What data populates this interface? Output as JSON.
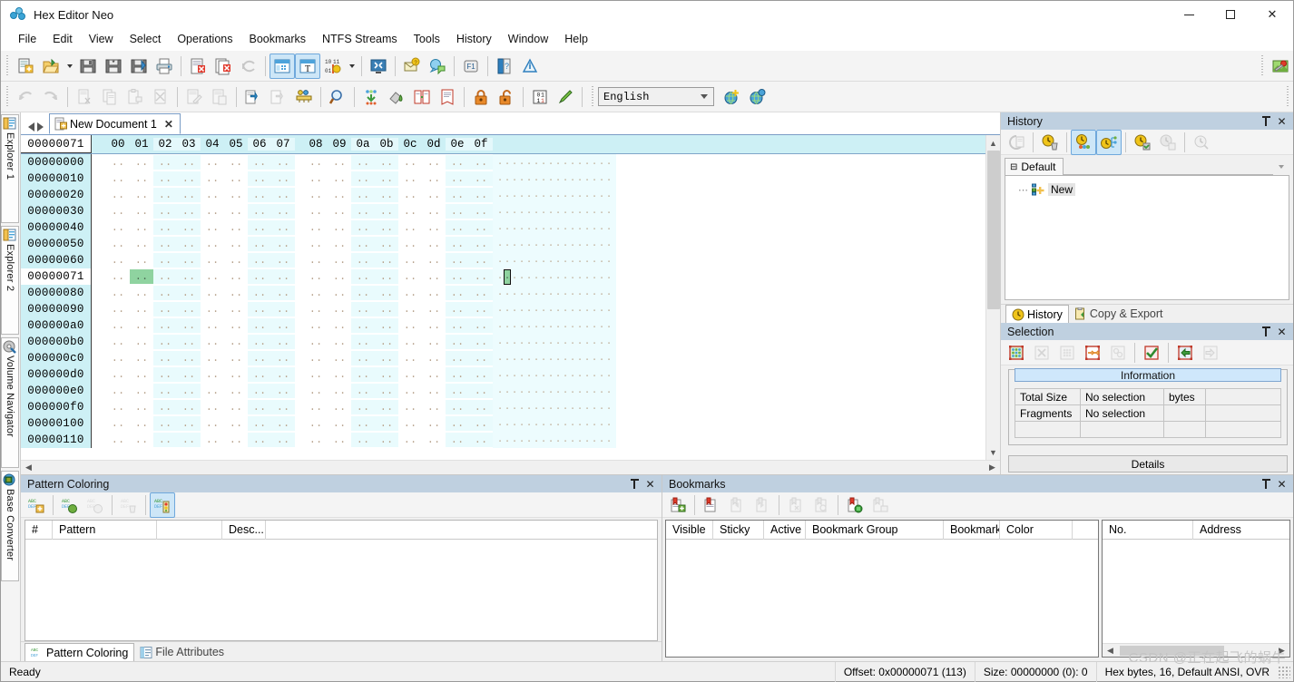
{
  "window": {
    "title": "Hex Editor Neo",
    "logo_icon": "hex-editor-neo-logo",
    "minimize_label": "Minimize",
    "maximize_label": "Maximize",
    "close_label": "Close"
  },
  "menubar": {
    "items": [
      {
        "label": "File"
      },
      {
        "label": "Edit"
      },
      {
        "label": "View"
      },
      {
        "label": "Select"
      },
      {
        "label": "Operations"
      },
      {
        "label": "Bookmarks"
      },
      {
        "label": "NTFS Streams"
      },
      {
        "label": "Tools"
      },
      {
        "label": "History"
      },
      {
        "label": "Window"
      },
      {
        "label": "Help"
      }
    ]
  },
  "toolbar_main": {
    "buttons": [
      {
        "name": "new-document-icon",
        "tip": "New Document"
      },
      {
        "name": "open-file-icon",
        "tip": "Open File"
      },
      {
        "name": "open-file-dropdown-icon",
        "tip": "Open recent"
      },
      {
        "name": "save-icon",
        "tip": "Save"
      },
      {
        "name": "save-as-icon",
        "tip": "Save As"
      },
      {
        "name": "save-all-icon",
        "tip": "Save All"
      },
      {
        "name": "print-icon",
        "tip": "Print"
      },
      {
        "name": "close-document-icon",
        "tip": "Close Document"
      },
      {
        "name": "close-all-documents-icon",
        "tip": "Close All Documents"
      },
      {
        "name": "refresh-icon",
        "tip": "Refresh"
      },
      {
        "name": "hex-view-icon",
        "tip": "Hex View"
      },
      {
        "name": "text-view-icon",
        "tip": "Text View"
      },
      {
        "name": "data-encoding-icon",
        "tip": "Data Encoding"
      },
      {
        "name": "data-encoding-dropdown-icon",
        "tip": "Data Encoding Options"
      },
      {
        "name": "fullscreen-icon",
        "tip": "Full Screen"
      },
      {
        "name": "send-feedback-icon",
        "tip": "Send Feedback"
      },
      {
        "name": "support-icon",
        "tip": "Support"
      },
      {
        "name": "help-f1-icon",
        "tip": "Help"
      },
      {
        "name": "manual-icon",
        "tip": "Manual"
      },
      {
        "name": "about-icon",
        "tip": "About"
      },
      {
        "name": "customize-icon",
        "tip": "Customize"
      }
    ]
  },
  "toolbar_edit": {
    "language_value": "English",
    "language_placeholder": "English",
    "buttons": [
      {
        "name": "undo-icon",
        "tip": "Undo"
      },
      {
        "name": "redo-icon",
        "tip": "Redo"
      },
      {
        "name": "cut-icon",
        "tip": "Cut"
      },
      {
        "name": "copy-icon",
        "tip": "Copy"
      },
      {
        "name": "paste-icon",
        "tip": "Paste"
      },
      {
        "name": "delete-icon",
        "tip": "Delete"
      },
      {
        "name": "edit-icon",
        "tip": "Edit"
      },
      {
        "name": "clipboard-icon",
        "tip": "Clipboard"
      },
      {
        "name": "export-icon",
        "tip": "Export"
      },
      {
        "name": "import-icon",
        "tip": "Import"
      },
      {
        "name": "measure-icon",
        "tip": "Measure"
      },
      {
        "name": "find-icon",
        "tip": "Find"
      },
      {
        "name": "fill-icon",
        "tip": "Fill"
      },
      {
        "name": "paint-icon",
        "tip": "Pattern Color"
      },
      {
        "name": "compare-icon",
        "tip": "Compare"
      },
      {
        "name": "checksum-icon",
        "tip": "Checksum"
      },
      {
        "name": "lock-icon",
        "tip": "Read Only"
      },
      {
        "name": "unlock-icon",
        "tip": "Read Write"
      },
      {
        "name": "binary-mode-icon",
        "tip": "Binary Mode"
      },
      {
        "name": "pencil-icon",
        "tip": "Edit Mode"
      },
      {
        "name": "add-language-icon",
        "tip": "Add Language"
      },
      {
        "name": "language-options-icon",
        "tip": "Language Options"
      }
    ]
  },
  "left_dock": {
    "tabs": [
      {
        "label": "Explorer 1",
        "icon": "explorer-icon"
      },
      {
        "label": "Explorer 2",
        "icon": "explorer-icon"
      },
      {
        "label": "Volume Navigator",
        "icon": "volume-navigator-icon"
      },
      {
        "label": "Base Converter",
        "icon": "base-converter-icon"
      }
    ]
  },
  "document": {
    "tab_label": "New Document 1",
    "tab_icon": "document-icon",
    "close_label": "✕",
    "prev_label": "Previous document",
    "next_label": "Next document"
  },
  "hexview": {
    "current_offset_label": "00000071",
    "columns": [
      "00",
      "01",
      "02",
      "03",
      "04",
      "05",
      "06",
      "07",
      "08",
      "09",
      "0a",
      "0b",
      "0c",
      "0d",
      "0e",
      "0f"
    ],
    "rows": [
      {
        "offset": "00000000",
        "current": false
      },
      {
        "offset": "00000010",
        "current": false
      },
      {
        "offset": "00000020",
        "current": false
      },
      {
        "offset": "00000030",
        "current": false
      },
      {
        "offset": "00000040",
        "current": false
      },
      {
        "offset": "00000050",
        "current": false
      },
      {
        "offset": "00000060",
        "current": false
      },
      {
        "offset": "00000071",
        "current": true
      },
      {
        "offset": "00000080",
        "current": false
      },
      {
        "offset": "00000090",
        "current": false
      },
      {
        "offset": "000000a0",
        "current": false
      },
      {
        "offset": "000000b0",
        "current": false
      },
      {
        "offset": "000000c0",
        "current": false
      },
      {
        "offset": "000000d0",
        "current": false
      },
      {
        "offset": "000000e0",
        "current": false
      },
      {
        "offset": "000000f0",
        "current": false
      },
      {
        "offset": "00000100",
        "current": false
      },
      {
        "offset": "00000110",
        "current": false
      }
    ],
    "byte_placeholder": "..",
    "ascii_placeholder": ".",
    "cursor_row_index": 7,
    "cursor_col_index": 1,
    "selection_color": "#8fd3a0",
    "row_band_color": "#cdf0f5"
  },
  "history_panel": {
    "title": "History",
    "pin_label": "Auto Hide",
    "close_label": "✕",
    "toolbar_buttons": [
      {
        "name": "history-properties-icon",
        "tip": "Properties"
      },
      {
        "name": "clear-history-icon",
        "tip": "Clear History"
      },
      {
        "name": "show-branches-icon",
        "tip": "Show Branches"
      },
      {
        "name": "tree-view-icon",
        "tip": "Tree View"
      },
      {
        "name": "save-history-icon",
        "tip": "Save History"
      },
      {
        "name": "load-history-icon",
        "tip": "Load History"
      },
      {
        "name": "history-settings-icon",
        "tip": "History Settings"
      }
    ],
    "group_tab": "Default",
    "chevron_label": "⌄",
    "node_label": "New",
    "node_icon": "new-node-icon",
    "node_dots": "⋯",
    "bottom_tabs": [
      {
        "label": "History",
        "icon": "history-clock-icon",
        "active": true
      },
      {
        "label": "Copy & Export",
        "icon": "copy-export-icon",
        "active": false
      }
    ]
  },
  "selection_panel": {
    "title": "Selection",
    "pin_label": "Auto Hide",
    "close_label": "✕",
    "toolbar_buttons": [
      {
        "name": "select-all-icon",
        "tip": "Select All"
      },
      {
        "name": "clear-selection-icon",
        "tip": "Clear Selection"
      },
      {
        "name": "invert-selection-icon",
        "tip": "Invert Selection"
      },
      {
        "name": "select-range-icon",
        "tip": "Select Range"
      },
      {
        "name": "select-pattern-icon",
        "tip": "Select Pattern"
      },
      {
        "name": "apply-selection-icon",
        "tip": "Apply"
      },
      {
        "name": "save-selection-icon",
        "tip": "Save Selection"
      },
      {
        "name": "load-selection-icon",
        "tip": "Load Selection"
      }
    ],
    "information_caption": "Information",
    "table": {
      "rows": [
        {
          "key": "Total Size",
          "value": "No selection",
          "unit": "bytes"
        },
        {
          "key": "Fragments",
          "value": "No selection",
          "unit": ""
        },
        {
          "key": "",
          "value": "",
          "unit": ""
        }
      ]
    },
    "details_label": "Details"
  },
  "pattern_coloring_panel": {
    "title": "Pattern Coloring",
    "pin_label": "Auto Hide",
    "close_label": "✕",
    "toolbar_buttons": [
      {
        "name": "add-pattern-icon",
        "tip": "Add Pattern"
      },
      {
        "name": "apply-pattern-icon",
        "tip": "Apply Pattern"
      },
      {
        "name": "disable-pattern-icon",
        "tip": "Disable Pattern"
      },
      {
        "name": "delete-pattern-icon",
        "tip": "Delete Pattern"
      },
      {
        "name": "pattern-properties-icon",
        "tip": "Pattern Properties"
      }
    ],
    "columns": [
      {
        "label": "#",
        "width": 30
      },
      {
        "label": "Pattern",
        "width": 115
      },
      {
        "label": "",
        "width": 72
      },
      {
        "label": "Desc...",
        "width": 48
      }
    ],
    "rows": [],
    "bottom_tabs": [
      {
        "label": "Pattern Coloring",
        "icon": "pattern-coloring-icon",
        "active": true
      },
      {
        "label": "File Attributes",
        "icon": "file-attributes-icon",
        "active": false
      }
    ]
  },
  "bookmarks_panel": {
    "title": "Bookmarks",
    "pin_label": "Auto Hide",
    "close_label": "✕",
    "toolbar_buttons": [
      {
        "name": "add-bookmark-icon",
        "tip": "Add Bookmark"
      },
      {
        "name": "edit-bookmark-icon",
        "tip": "Edit Bookmark"
      },
      {
        "name": "previous-bookmark-icon",
        "tip": "Previous Bookmark"
      },
      {
        "name": "next-bookmark-icon",
        "tip": "Next Bookmark"
      },
      {
        "name": "remove-bookmark-icon",
        "tip": "Remove Bookmark"
      },
      {
        "name": "remove-all-bookmarks-icon",
        "tip": "Remove All Bookmarks"
      },
      {
        "name": "import-bookmarks-icon",
        "tip": "Import Bookmarks"
      },
      {
        "name": "export-bookmarks-icon",
        "tip": "Export Bookmarks"
      }
    ],
    "group_columns": [
      {
        "label": "Visible",
        "width": 52
      },
      {
        "label": "Sticky",
        "width": 56
      },
      {
        "label": "Active",
        "width": 46
      },
      {
        "label": "Bookmark Group",
        "width": 152
      },
      {
        "label": "Bookmarks",
        "width": 62
      },
      {
        "label": "Color",
        "width": 80
      },
      {
        "label": "",
        "width": 40
      }
    ],
    "group_rows": [],
    "detail_columns": [
      {
        "label": "No.",
        "width": 100
      },
      {
        "label": "Address",
        "width": 106
      }
    ],
    "detail_rows": []
  },
  "statusbar": {
    "ready_label": "Ready",
    "offset_label": "Offset: 0x00000071 (113)",
    "size_label": "Size: 00000000 (0): 0",
    "mode_label": "Hex bytes, 16, Default ANSI, OVR"
  },
  "watermark": {
    "text": "CSDN @正在起飞的蜗牛"
  }
}
